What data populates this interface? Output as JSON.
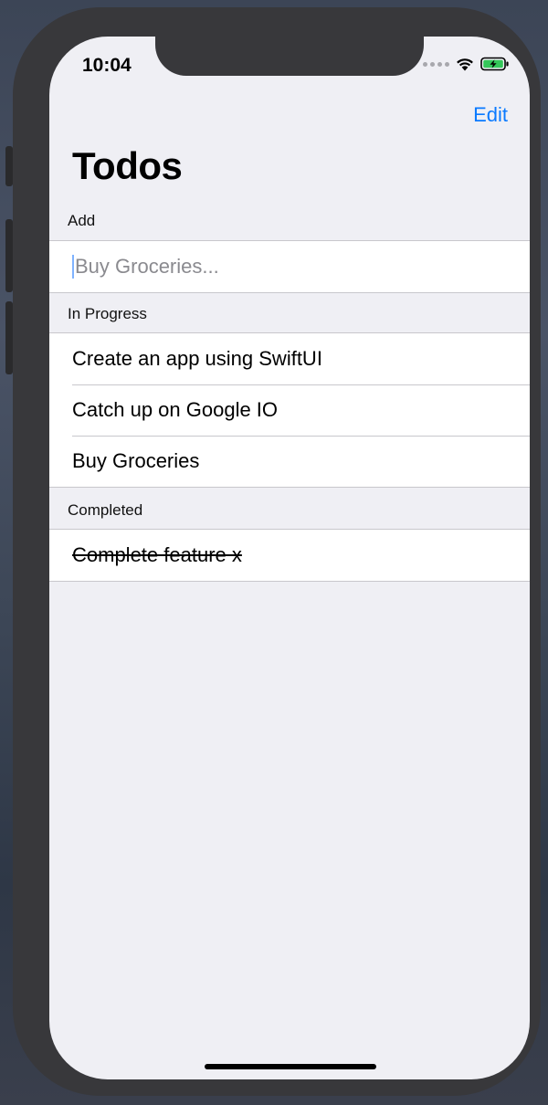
{
  "status_bar": {
    "time": "10:04"
  },
  "nav": {
    "edit_label": "Edit",
    "title": "Todos"
  },
  "add_section": {
    "header": "Add",
    "placeholder": "Buy Groceries..."
  },
  "in_progress": {
    "header": "In Progress",
    "items": [
      {
        "label": "Create an app using SwiftUI"
      },
      {
        "label": "Catch up on Google IO"
      },
      {
        "label": "Buy Groceries"
      }
    ]
  },
  "completed": {
    "header": "Completed",
    "items": [
      {
        "label": "Complete feature x"
      }
    ]
  },
  "colors": {
    "accent": "#0a7aff",
    "background": "#efeff4",
    "cell": "#ffffff",
    "separator": "#c8c7cc",
    "battery": "#34c759"
  }
}
